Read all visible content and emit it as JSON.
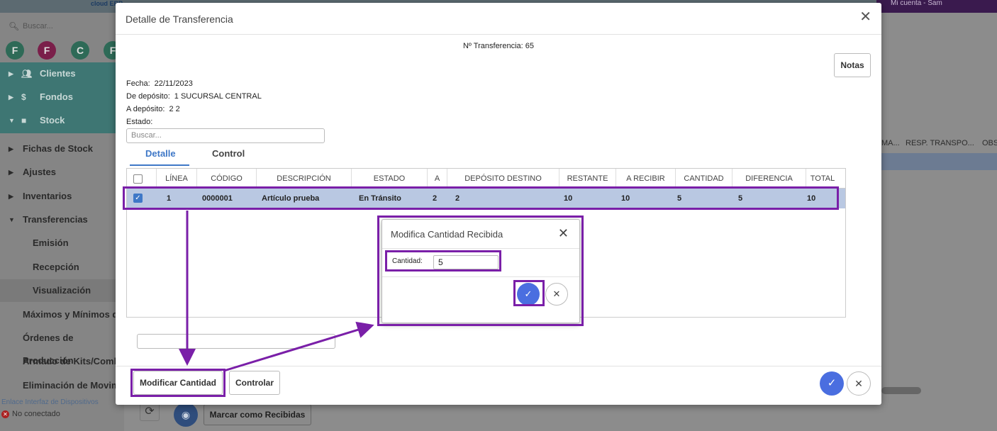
{
  "background": {
    "topbar": {
      "logo_text": "cloud ERP",
      "right_text": "Mi cuenta - Sam"
    },
    "sidebar": {
      "search_placeholder": "Buscar...",
      "circles": [
        {
          "letter": "F",
          "color": "#2e6a57"
        },
        {
          "letter": "F",
          "color": "#7a1f4a"
        },
        {
          "letter": "C",
          "color": "#2e6a57"
        },
        {
          "letter": "F",
          "color": "#2e6a57"
        }
      ],
      "teal_items": [
        {
          "icon": "users-icon",
          "label": "Clientes"
        },
        {
          "icon": "dollar-icon",
          "label": "Fondos"
        },
        {
          "icon": "box-icon",
          "label": "Stock"
        }
      ],
      "items": [
        {
          "label": "Fichas de Stock"
        },
        {
          "label": "Ajustes"
        },
        {
          "label": "Inventarios"
        },
        {
          "label": "Transferencias"
        },
        {
          "label": "Emisión"
        },
        {
          "label": "Recepción"
        },
        {
          "label": "Visualización"
        },
        {
          "label": "Máximos y Mínimos de"
        },
        {
          "label": "Órdenes de Producción"
        },
        {
          "label": "Armado de Kits/Comb"
        },
        {
          "label": "Eliminación de Movimi"
        }
      ],
      "status": {
        "link": "Enlace Interfaz de Dispositivos",
        "state": "No conectado"
      }
    },
    "columns_right": [
      "MA...",
      "RESP. TRANSPO...",
      "OBS"
    ],
    "mark_button": "Marcar como Recibidas"
  },
  "modal": {
    "title": "Detalle de Transferencia",
    "transfer_number": "Nº Transferencia: 65",
    "notes_button": "Notas",
    "fields": {
      "fecha_label": "Fecha:",
      "fecha_value": "22/11/2023",
      "de_label": "De depósito:",
      "de_value": "1  SUCURSAL CENTRAL",
      "a_label": "A depósito:",
      "a_value": "2  2",
      "estado_label": "Estado:"
    },
    "search_placeholder": "Buscar...",
    "tabs": [
      "Detalle",
      "Control"
    ],
    "table": {
      "headers": [
        "LÍNEA",
        "CÓDIGO",
        "DESCRIPCIÓN",
        "ESTADO",
        "A",
        "DEPÓSITO DESTINO",
        "RESTANTE",
        "A RECIBIR",
        "CANTIDAD",
        "DIFERENCIA",
        "TOTAL"
      ],
      "rows": [
        [
          "1",
          "0000001",
          "Artículo prueba",
          "En Tránsito",
          "2",
          "2",
          "10",
          "10",
          "5",
          "5",
          "10"
        ]
      ]
    },
    "buttons": {
      "modify": "Modificar Cantidad",
      "control": "Controlar"
    }
  },
  "dialog": {
    "title": "Modifica Cantidad Recibida",
    "quantity_label": "Cantidad:",
    "quantity_value": "5"
  }
}
